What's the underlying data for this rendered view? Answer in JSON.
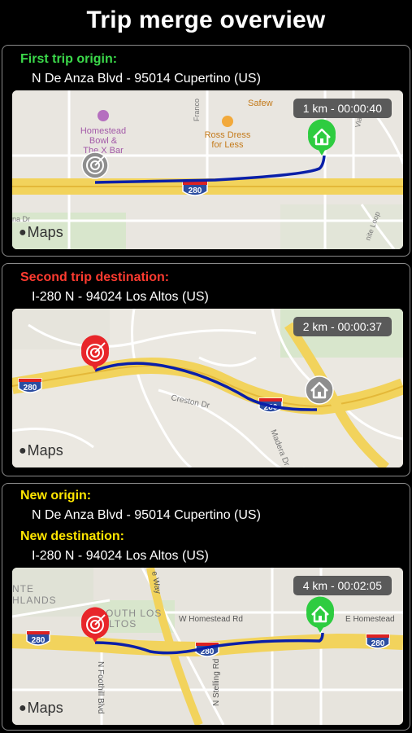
{
  "title": "Trip merge overview",
  "first": {
    "label": "First trip origin:",
    "address": "N De Anza Blvd - 95014 Cupertino (US)",
    "badge": "1 km - 00:00:40",
    "map_labels": {
      "poi1": "Homestead",
      "poi1b": "Bowl &",
      "poi1c": "The X Bar",
      "poi2": "Ross Dress",
      "poi2b": "for Less",
      "poi3": "Safew",
      "street1": "Franco",
      "street2": "Via Lo",
      "street3": "na Dr",
      "street4": "nite Loop",
      "hwy": "280"
    }
  },
  "second": {
    "label": "Second trip destination:",
    "address": "I-280 N - 94024 Los Altos (US)",
    "badge": "2 km - 00:00:37",
    "map_labels": {
      "street1": "Creston Dr",
      "street2": "Madera Dr",
      "hwy1": "280",
      "hwy2": "280"
    }
  },
  "merged": {
    "origin_label": "New origin:",
    "origin_address": "N De Anza Blvd - 95014 Cupertino (US)",
    "dest_label": "New destination:",
    "dest_address": "I-280 N - 94024 Los Altos (US)",
    "badge": "4 km - 00:02:05",
    "map_labels": {
      "area1": "NTE",
      "area1b": "HLANDS",
      "area2": "SOUTH LOS",
      "area2b": "ALTOS",
      "street1": "W Homestead Rd",
      "street2": "E Homestead",
      "street3": "N Foothill Blvd",
      "street4": "N Stelling Rd",
      "street5": "e Way",
      "hwy1": "280",
      "hwy2": "280",
      "hwy3": "280"
    }
  },
  "maps_brand": "Maps",
  "colors": {
    "route": "#0a1fa8",
    "origin_pin": "#2ecc40",
    "dest_pin": "#e8262a",
    "inactive_pin": "#8e8e8e",
    "highway": "#f2d35c"
  }
}
